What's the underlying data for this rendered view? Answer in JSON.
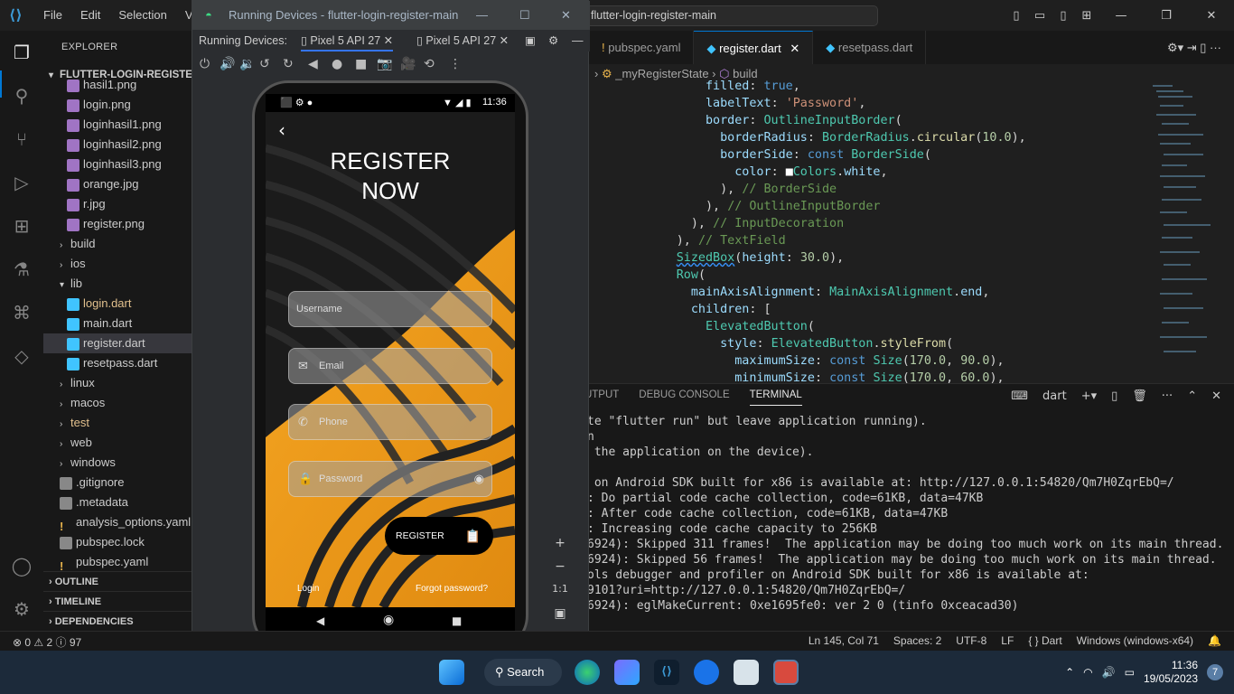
{
  "titlebar": {
    "menu": [
      "File",
      "Edit",
      "Selection",
      "View"
    ],
    "command_center": "flutter-login-register-main"
  },
  "emulator": {
    "title": "Running Devices - flutter-login-register-main",
    "running_label": "Running Devices:",
    "device_tabs": [
      "Pixel 5 API 27",
      "Pixel 5 API 27"
    ],
    "status_time": "11:36",
    "app": {
      "heading_line1": "REGISTER",
      "heading_line2": "NOW",
      "username_placeholder": "Username",
      "email_placeholder": "Email",
      "phone_placeholder": "Phone",
      "password_placeholder": "Password",
      "register_label": "REGISTER",
      "login_link": "Login",
      "forgot_link": "Forgot password?",
      "accent_color": "#f5a623"
    },
    "zoom_label": "1:1"
  },
  "explorer": {
    "header": "EXPLORER",
    "project": "FLUTTER-LOGIN-REGISTER-M...",
    "items": [
      {
        "label": "hasil1.png",
        "kind": "png",
        "depth": 2
      },
      {
        "label": "login.png",
        "kind": "png",
        "depth": 2
      },
      {
        "label": "loginhasil1.png",
        "kind": "png",
        "depth": 2
      },
      {
        "label": "loginhasil2.png",
        "kind": "png",
        "depth": 2
      },
      {
        "label": "loginhasil3.png",
        "kind": "png",
        "depth": 2
      },
      {
        "label": "orange.jpg",
        "kind": "png",
        "depth": 2
      },
      {
        "label": "r.jpg",
        "kind": "png",
        "depth": 2
      },
      {
        "label": "register.png",
        "kind": "png",
        "depth": 2
      },
      {
        "label": "build",
        "kind": "folder",
        "depth": 1
      },
      {
        "label": "ios",
        "kind": "folder",
        "depth": 1
      },
      {
        "label": "lib",
        "kind": "folder-open",
        "depth": 1
      },
      {
        "label": "login.dart",
        "kind": "dart",
        "depth": 2
      },
      {
        "label": "main.dart",
        "kind": "dart",
        "depth": 2
      },
      {
        "label": "register.dart",
        "kind": "dart",
        "depth": 2
      },
      {
        "label": "resetpass.dart",
        "kind": "dart",
        "depth": 2
      },
      {
        "label": "linux",
        "kind": "folder",
        "depth": 1
      },
      {
        "label": "macos",
        "kind": "folder",
        "depth": 1
      },
      {
        "label": "test",
        "kind": "folder",
        "depth": 1
      },
      {
        "label": "web",
        "kind": "folder",
        "depth": 1
      },
      {
        "label": "windows",
        "kind": "folder",
        "depth": 1
      },
      {
        "label": ".gitignore",
        "kind": "git",
        "depth": 1
      },
      {
        "label": ".metadata",
        "kind": "meta",
        "depth": 1
      },
      {
        "label": "analysis_options.yaml",
        "kind": "yaml",
        "depth": 1
      },
      {
        "label": "pubspec.lock",
        "kind": "lock",
        "depth": 1
      },
      {
        "label": "pubspec.yaml",
        "kind": "yaml",
        "depth": 1
      }
    ],
    "sections": [
      "OUTLINE",
      "TIMELINE",
      "DEPENDENCIES"
    ]
  },
  "editor": {
    "tabs": [
      "pubspec.yaml",
      "register.dart",
      "resetpass.dart"
    ],
    "breadcrumb_state": "_myRegisterState",
    "breadcrumb_method": "build"
  },
  "panel": {
    "tabs": [
      "OUTPUT",
      "DEBUG CONSOLE",
      "TERMINAL"
    ],
    "shell": "dart",
    "lines": [
      "te \"flutter run\" but leave application running).",
      "n",
      " the application on the device).",
      "",
      " on Android SDK built for x86 is available at: http://127.0.0.1:54820/Qm7H0ZqrEbQ=/",
      ": Do partial code cache collection, code=61KB, data=47KB",
      ": After code cache collection, code=61KB, data=47KB",
      ": Increasing code cache capacity to 256KB",
      "6924): Skipped 311 frames!  The application may be doing too much work on its main thread.",
      "6924): Skipped 56 frames!  The application may be doing too much work on its main thread.",
      "ols debugger and profiler on Android SDK built for x86 is available at:",
      "9101?uri=http://127.0.0.1:54820/Qm7H0ZqrEbQ=/",
      "6924): eglMakeCurrent: 0xe1695fe0: ver 2 0 (tinfo 0xceacad30)"
    ]
  },
  "status": {
    "errors": "0",
    "warnings": "2",
    "info": "97",
    "position": "Ln 145, Col 71",
    "spaces": "Spaces: 2",
    "encoding": "UTF-8",
    "eol": "LF",
    "language": "{ } Dart",
    "device": "Windows (windows-x64)"
  },
  "taskbar": {
    "search": "Search",
    "time": "11:36",
    "date": "19/05/2023",
    "notifications": "7"
  }
}
